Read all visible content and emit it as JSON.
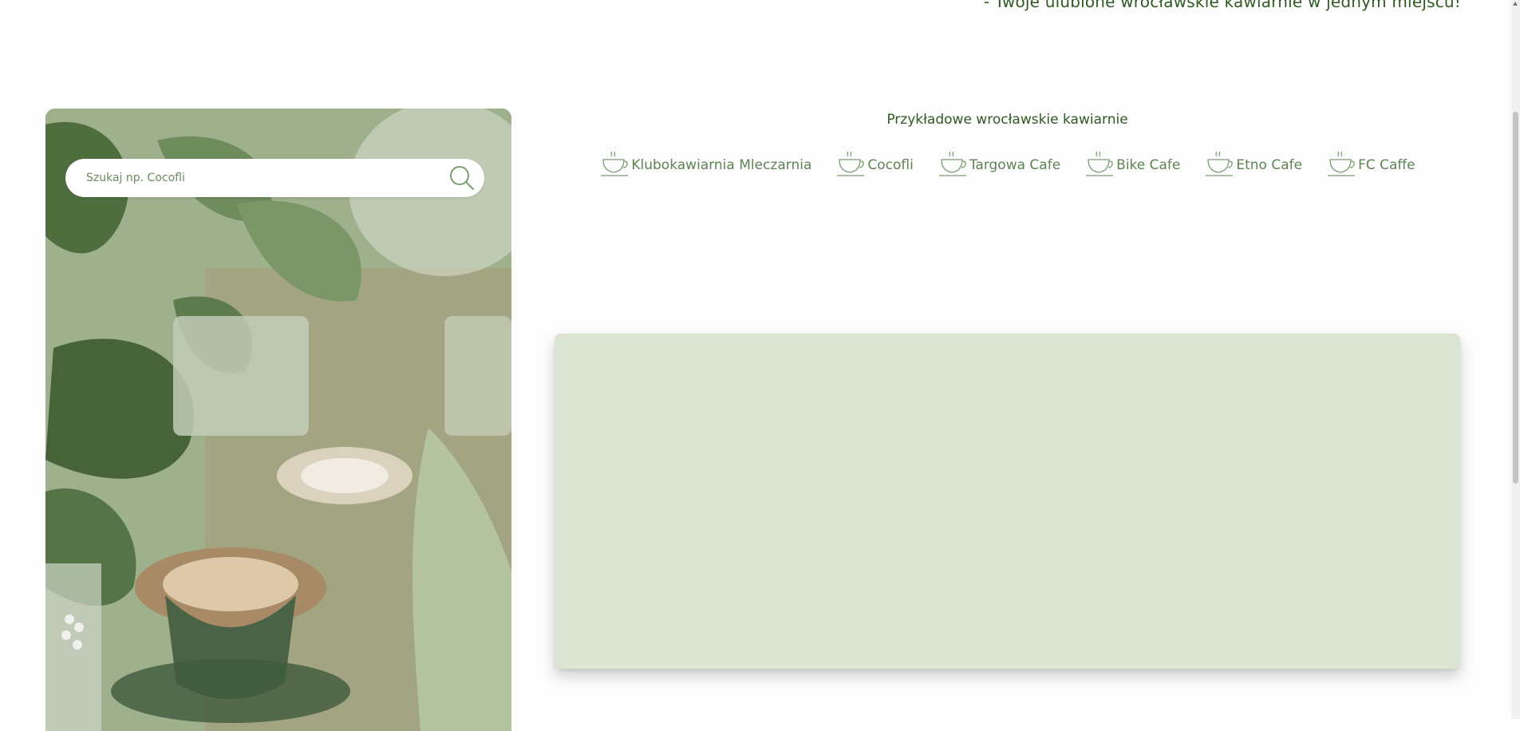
{
  "header": {
    "tagline": "- Twoje ulubione wrocławskie kawiarnie w jednym miejscu!"
  },
  "search": {
    "placeholder": "Szukaj np. Cocofli",
    "value": ""
  },
  "cafes": {
    "title": "Przykładowe wrocławskie kawiarnie",
    "items": [
      {
        "label": "Klubokawiarnia Mleczarnia",
        "icon": "coffee-cup-icon"
      },
      {
        "label": "Cocofli",
        "icon": "coffee-cup-icon"
      },
      {
        "label": "Targowa Cafe",
        "icon": "coffee-cup-icon"
      },
      {
        "label": "Bike Cafe",
        "icon": "coffee-cup-icon"
      },
      {
        "label": "Etno Cafe",
        "icon": "coffee-cup-icon"
      },
      {
        "label": "FC Caffe",
        "icon": "coffee-cup-icon"
      }
    ]
  },
  "colors": {
    "accent": "#2f5a22",
    "link": "#5e8454",
    "map_background": "#dce5d3"
  }
}
